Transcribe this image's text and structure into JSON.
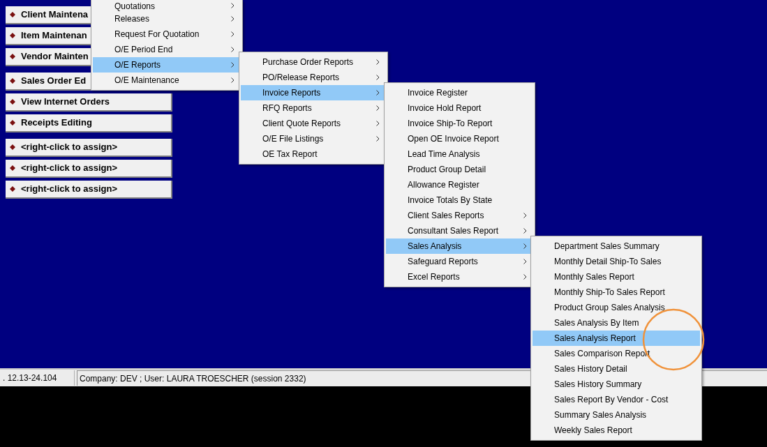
{
  "shortcut_groups": [
    [
      "Client Maintena",
      "Item Maintenan",
      "Vendor Mainten"
    ],
    [
      "Sales Order Ed",
      "View Internet Orders",
      "Receipts Editing"
    ],
    [
      "<right-click to assign>",
      "<right-click to assign>",
      "<right-click to assign>"
    ]
  ],
  "menus": [
    [
      {
        "label": "Quotations",
        "submenu": true,
        "selected": false
      },
      {
        "label": "Releases",
        "submenu": true,
        "selected": false
      },
      {
        "label": "Request For Quotation",
        "submenu": true,
        "selected": false
      },
      {
        "label": "O/E Period End",
        "submenu": true,
        "selected": false
      },
      {
        "label": "O/E Reports",
        "submenu": true,
        "selected": true
      },
      {
        "label": "O/E Maintenance",
        "submenu": true,
        "selected": false
      }
    ],
    [
      {
        "label": "Purchase Order Reports",
        "submenu": true,
        "selected": false
      },
      {
        "label": "PO/Release Reports",
        "submenu": true,
        "selected": false
      },
      {
        "label": "Invoice Reports",
        "submenu": true,
        "selected": true
      },
      {
        "label": "RFQ Reports",
        "submenu": true,
        "selected": false
      },
      {
        "label": "Client Quote Reports",
        "submenu": true,
        "selected": false
      },
      {
        "label": "O/E File Listings",
        "submenu": true,
        "selected": false
      },
      {
        "label": "OE Tax Report",
        "submenu": false,
        "selected": false
      }
    ],
    [
      {
        "label": "Invoice Register",
        "submenu": false,
        "selected": false
      },
      {
        "label": "Invoice Hold Report",
        "submenu": false,
        "selected": false
      },
      {
        "label": "Invoice Ship-To Report",
        "submenu": false,
        "selected": false
      },
      {
        "label": "Open OE Invoice Report",
        "submenu": false,
        "selected": false
      },
      {
        "label": "Lead Time Analysis",
        "submenu": false,
        "selected": false
      },
      {
        "label": "Product Group Detail",
        "submenu": false,
        "selected": false
      },
      {
        "label": "Allowance Register",
        "submenu": false,
        "selected": false
      },
      {
        "label": "Invoice Totals By State",
        "submenu": false,
        "selected": false
      },
      {
        "label": "Client Sales Reports",
        "submenu": true,
        "selected": false
      },
      {
        "label": "Consultant Sales Report",
        "submenu": true,
        "selected": false
      },
      {
        "label": "Sales Analysis",
        "submenu": true,
        "selected": true
      },
      {
        "label": "Safeguard Reports",
        "submenu": true,
        "selected": false
      },
      {
        "label": "Excel Reports",
        "submenu": true,
        "selected": false
      }
    ],
    [
      {
        "label": "Department Sales Summary",
        "submenu": false,
        "selected": false
      },
      {
        "label": "Monthly Detail Ship-To Sales",
        "submenu": false,
        "selected": false
      },
      {
        "label": "Monthly Sales Report",
        "submenu": false,
        "selected": false
      },
      {
        "label": "Monthly Ship-To Sales Report",
        "submenu": false,
        "selected": false
      },
      {
        "label": "Product Group Sales Analysis",
        "submenu": false,
        "selected": false
      },
      {
        "label": "Sales Analysis By Item",
        "submenu": false,
        "selected": false
      },
      {
        "label": "Sales Analysis Report",
        "submenu": false,
        "selected": true
      },
      {
        "label": "Sales Comparison Report",
        "submenu": false,
        "selected": false
      },
      {
        "label": "Sales History Detail",
        "submenu": false,
        "selected": false
      },
      {
        "label": "Sales History Summary",
        "submenu": false,
        "selected": false
      },
      {
        "label": "Sales Report By Vendor - Cost",
        "submenu": false,
        "selected": false
      },
      {
        "label": "Summary Sales Analysis",
        "submenu": false,
        "selected": false
      },
      {
        "label": "Weekly Sales Report",
        "submenu": false,
        "selected": false
      }
    ]
  ],
  "status_bar": {
    "version": ". 12.13-24.104",
    "session": "Company: DEV ; User: LAURA TROESCHER (session 2332)"
  }
}
